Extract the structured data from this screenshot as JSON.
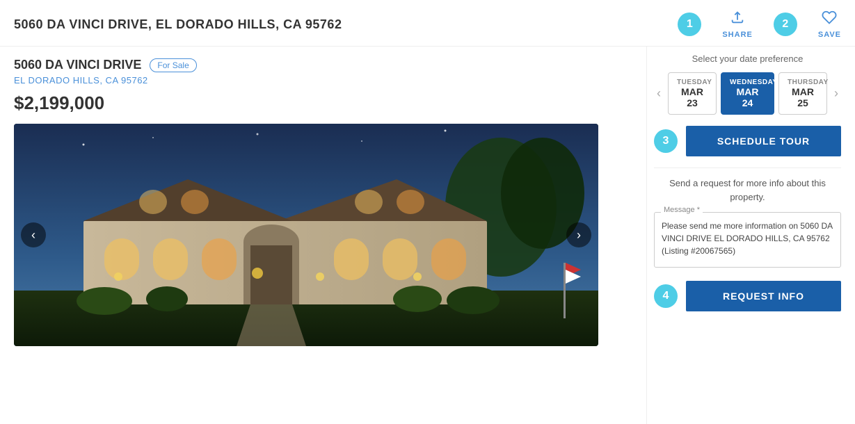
{
  "page": {
    "top_address": "5060 DA VINCI DRIVE, EL DORADO HILLS, CA 95762",
    "share_label": "SHARE",
    "save_label": "SAVE",
    "step1_badge": "1",
    "step2_badge": "2",
    "step3_badge": "3",
    "step4_badge": "4",
    "property": {
      "street": "5060 DA VINCI DRIVE",
      "for_sale": "For Sale",
      "city_state": "EL DORADO HILLS, CA 95762",
      "price": "$2,199,000"
    },
    "date_selector": {
      "label": "Select your date preference",
      "dates": [
        {
          "day": "TUESDAY",
          "date": "MAR 23",
          "selected": false
        },
        {
          "day": "WEDNESDAY",
          "date": "MAR 24",
          "selected": true
        },
        {
          "day": "THURSDAY",
          "date": "MAR 25",
          "selected": false
        }
      ]
    },
    "schedule_tour_btn": "SCHEDULE TOUR",
    "request_info_label": "Send a request for more info about this property.",
    "message_label": "Message *",
    "message_default": "Please send me more information on 5060 DA VINCI DRIVE EL DORADO HILLS, CA 95762 (Listing #20067565)",
    "request_info_btn": "REQUEST INFO"
  }
}
